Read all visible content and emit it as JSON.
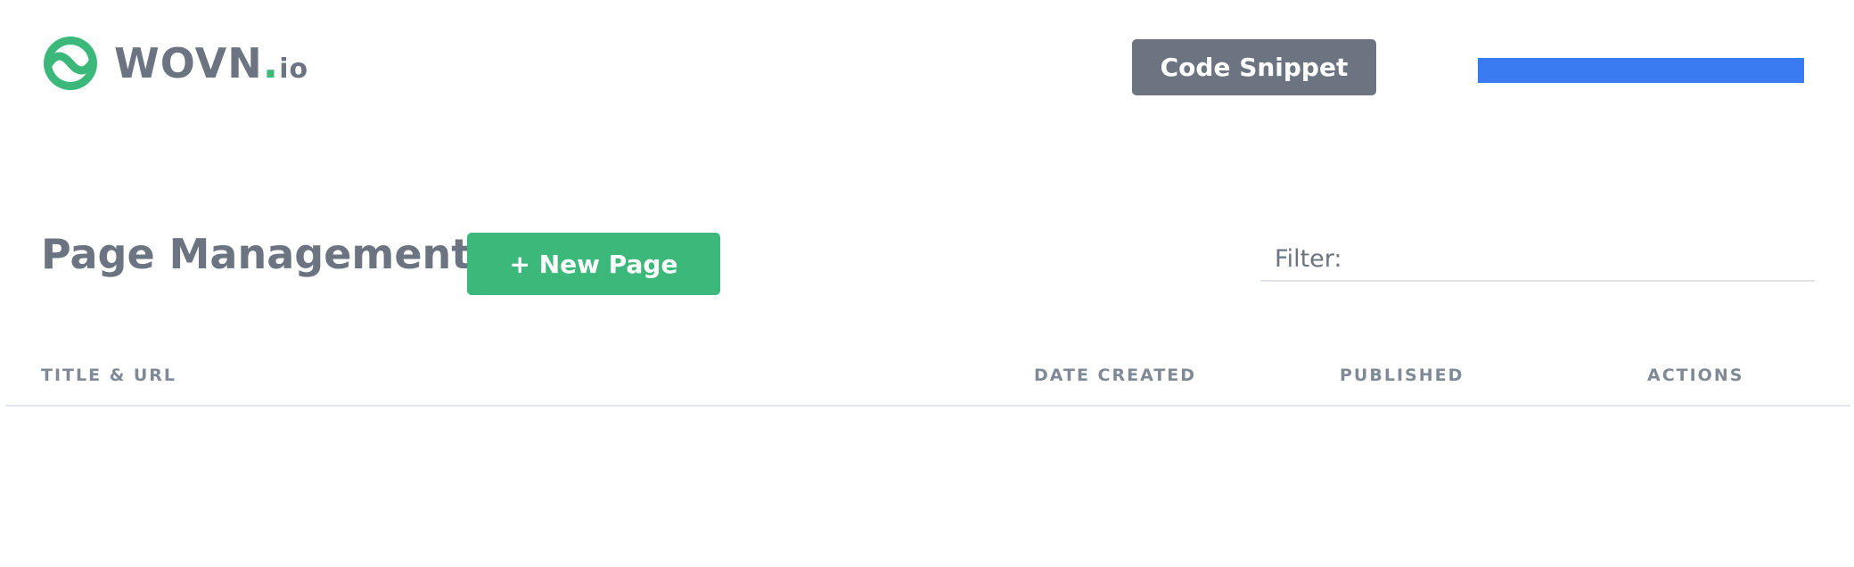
{
  "header": {
    "logo": {
      "brand_name": "WOVN",
      "dot": ".",
      "tld": "io",
      "icon": "wovn-logo-icon"
    },
    "code_snippet_label": "Code Snippet",
    "account_bar_color": "#3b7bf2"
  },
  "main": {
    "title": "Page Management",
    "new_page_label": "+ New Page",
    "filter": {
      "placeholder": "Filter:",
      "value": ""
    },
    "table": {
      "columns": [
        "TITLE & URL",
        "DATE CREATED",
        "PUBLISHED",
        "ACTIONS"
      ],
      "rows": []
    }
  },
  "colors": {
    "primary_text": "#6b7480",
    "accent_green": "#3cb87a",
    "button_gray": "#6b7480",
    "header_text": "#7f8a96",
    "divider": "#e2e6ec"
  }
}
